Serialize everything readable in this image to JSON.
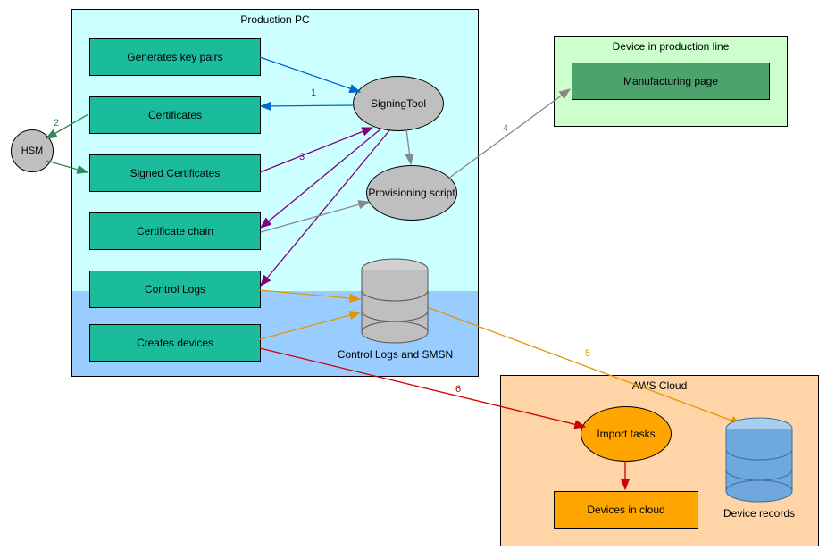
{
  "containers": {
    "productionPC": {
      "title": "Production PC"
    },
    "deviceLine": {
      "title": "Device in production line"
    },
    "awsCloud": {
      "title": "AWS Cloud"
    }
  },
  "boxes": {
    "keyPairs": "Generates key pairs",
    "certificates": "Certificates",
    "signedCerts": "Signed Certificates",
    "certChain": "Certificate chain",
    "controlLogs": "Control Logs",
    "createsDevices": "Creates devices",
    "manufacturing": "Manufacturing page",
    "devicesCloud": "Devices in cloud"
  },
  "ellipses": {
    "hsm": "HSM",
    "signingTool": "SigningTool",
    "provisioning": "Provisioning script",
    "importTasks": "Import tasks"
  },
  "databases": {
    "controlLogsDB": "Control Logs and SMSN",
    "deviceRecords": "Device records"
  },
  "labels": {
    "n1": "1",
    "n2": "2",
    "n3": "3",
    "n4": "4",
    "n5": "5",
    "n6": "6"
  },
  "colors": {
    "teal": "#1abc9c",
    "darkGreen": "#4ca36c",
    "lightCyan": "#ccffff",
    "lightBlue": "#99ccff",
    "lightGreen": "#ccffcc",
    "peach": "#ffd4a6",
    "orange": "#ffa500",
    "grey": "#bfbfbf",
    "blueArrow": "#0066cc",
    "greenArrow": "#2e8b57",
    "purpleArrow": "#800080",
    "greyArrow": "#888888",
    "orangeArrow": "#e69500",
    "redArrow": "#cc0000"
  }
}
